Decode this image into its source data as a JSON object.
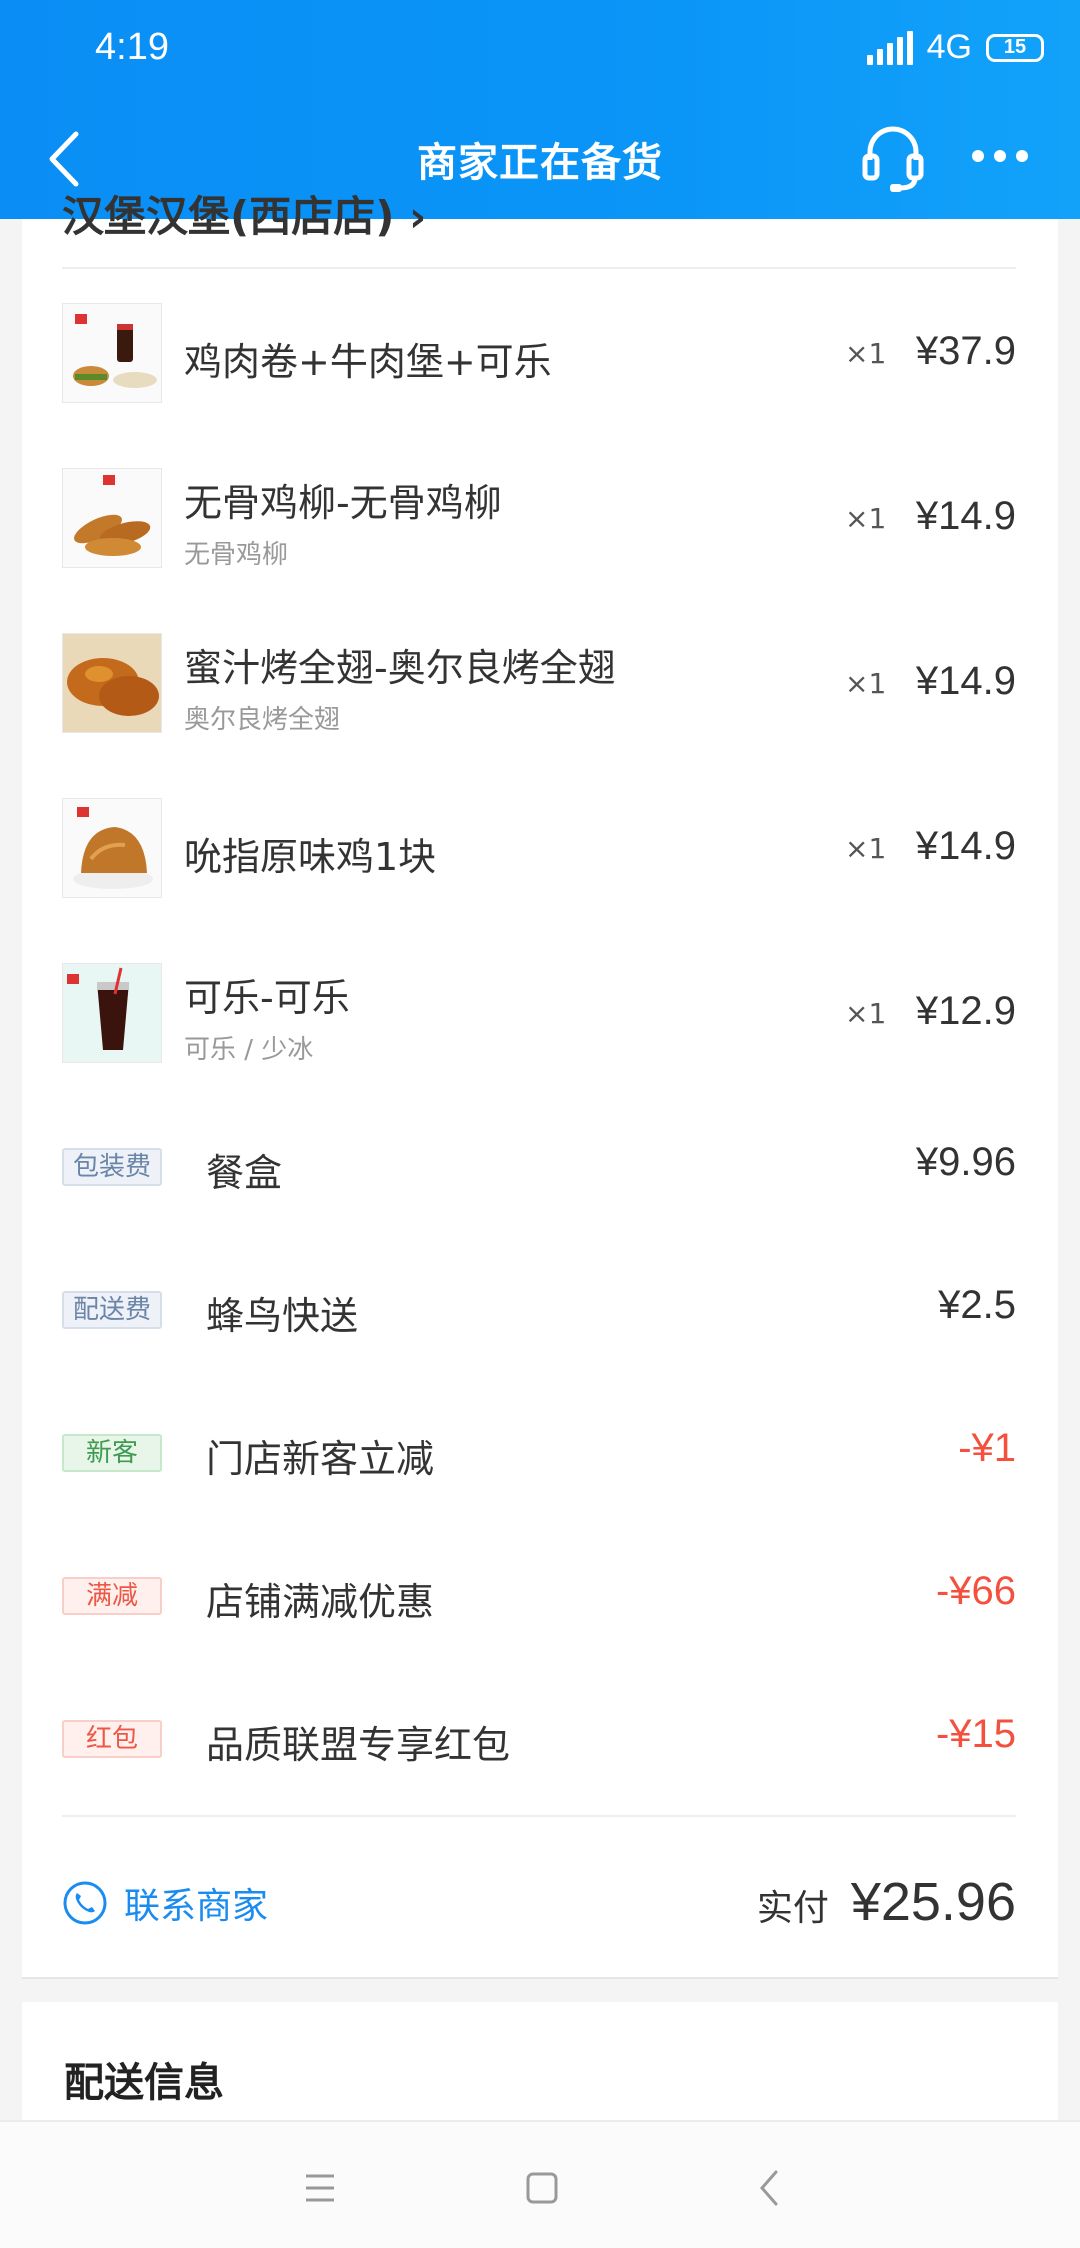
{
  "status_bar": {
    "time": "4:19",
    "network": "4G",
    "battery": "15"
  },
  "nav": {
    "title": "商家正在备货"
  },
  "shop": {
    "name_partial": "汉堡汉堡(西店店) ›"
  },
  "items": [
    {
      "name": "鸡肉卷+牛肉堡+可乐",
      "spec": "",
      "qty": "×1",
      "price": "¥37.9"
    },
    {
      "name": "无骨鸡柳-无骨鸡柳",
      "spec": "无骨鸡柳",
      "qty": "×1",
      "price": "¥14.9"
    },
    {
      "name": "蜜汁烤全翅-奥尔良烤全翅",
      "spec": "奥尔良烤全翅",
      "qty": "×1",
      "price": "¥14.9"
    },
    {
      "name": "吮指原味鸡1块",
      "spec": "",
      "qty": "×1",
      "price": "¥14.9"
    },
    {
      "name": "可乐-可乐",
      "spec": "可乐 / 少冰",
      "qty": "×1",
      "price": "¥12.9"
    }
  ],
  "fees": [
    {
      "tag": "包装费",
      "label": "餐盒",
      "value": "¥9.96"
    },
    {
      "tag": "配送费",
      "label": "蜂鸟快送",
      "value": "¥2.5"
    },
    {
      "tag": "新客",
      "label": "门店新客立减",
      "value": "-¥1"
    },
    {
      "tag": "满减",
      "label": "店铺满减优惠",
      "value": "-¥66"
    },
    {
      "tag": "红包",
      "label": "品质联盟专享红包",
      "value": "-¥15"
    }
  ],
  "footer": {
    "contact_label": "联系商家",
    "total_label": "实付",
    "total_value": "¥25.96"
  },
  "delivery": {
    "title": "配送信息"
  },
  "colors": {
    "header_blue": "#0a8ef5",
    "discount_red": "#f4503d",
    "link_blue": "#1a8cf1"
  }
}
